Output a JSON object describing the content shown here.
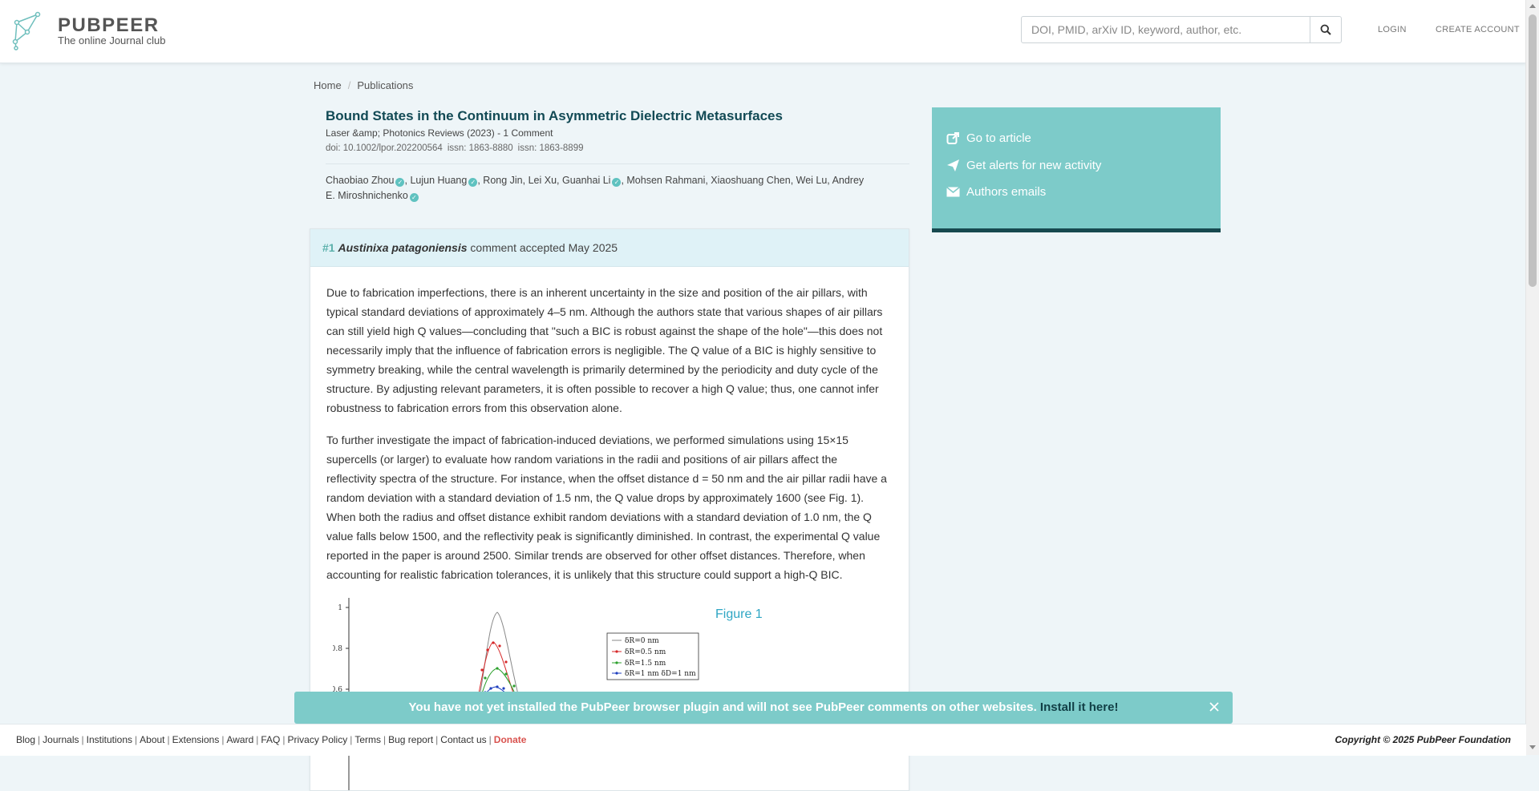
{
  "header": {
    "brand_name": "PUBPEER",
    "brand_tagline": "The online Journal club",
    "search_placeholder": "DOI, PMID, arXiv ID, keyword, author, etc.",
    "search_icon": "magnifier-icon",
    "login_label": "LOGIN",
    "create_account_label": "CREATE ACCOUNT"
  },
  "breadcrumb": {
    "home": "Home",
    "separator": "/",
    "current": "Publications"
  },
  "article": {
    "title": "Bound States in the Continuum in Asymmetric Dielectric Metasurfaces",
    "journal_line": "Laser &amp; Photonics Reviews (2023) - 1 Comment",
    "doi": "doi: 10.1002/lpor.202200564",
    "issn1": "issn: 1863-8880",
    "issn2": "issn: 1863-8899",
    "authors": [
      {
        "name": "Chaobiao Zhou",
        "verified": true,
        "sep": ", "
      },
      {
        "name": "Lujun Huang",
        "verified": true,
        "sep": ", "
      },
      {
        "name": "Rong Jin, Lei Xu, Guanhai Li",
        "verified": true,
        "sep": ", "
      },
      {
        "name": "Mohsen Rahmani, Xiaoshuang Chen, Wei Lu, Andrey E. Miroshnichenko",
        "verified": true,
        "sep": ""
      }
    ]
  },
  "comment": {
    "number": "#1",
    "author": "Austinixa patagoniensis",
    "status": "comment accepted May 2025",
    "paragraph1": "Due to fabrication imperfections, there is an inherent uncertainty in the size and position of the air pillars, with typical standard deviations of approximately 4–5 nm. Although the authors state that various shapes of air pillars can still yield high Q values—concluding that \"such a BIC is robust against the shape of the hole\"—this does not necessarily imply that the influence of fabrication errors is negligible. The Q value of a BIC is highly sensitive to symmetry breaking, while the central wavelength is primarily determined by the periodicity and duty cycle of the structure. By adjusting relevant parameters, it is often possible to recover a high Q value; thus, one cannot infer robustness to fabrication errors from this observation alone.",
    "paragraph2": "To further investigate the impact of fabrication-induced deviations, we performed simulations using 15×15 supercells (or larger) to evaluate how random variations in the radii and positions of air pillars affect the reflectivity spectra of the structure. For instance, when the offset distance d = 50 nm and the air pillar radii have a random deviation with a standard deviation of 1.5 nm, the Q value drops by approximately 1600 (see Fig. 1). When both the radius and offset distance exhibit random deviations with a standard deviation of 1.0 nm, the Q value falls below 1500, and the reflectivity peak is significantly diminished. In contrast, the experimental Q value reported in the paper is around 2500. Similar trends are observed for other offset distances. Therefore, when accounting for realistic fabrication tolerances, it is unlikely that this structure could support a high-Q BIC.",
    "figure_label": "Figure 1",
    "figure": {
      "y_ticks": [
        "1",
        "0.8",
        "0.6"
      ],
      "legend": [
        "δR=0 nm",
        "δR=0.5 nm",
        "δR=1.5 nm",
        "δR=1 nm  δD=1 nm"
      ],
      "series_colors": [
        "#888888",
        "#d62728",
        "#2ca02c",
        "#1f3fbf"
      ]
    }
  },
  "side_panel": {
    "go_to_article": "Go to article",
    "get_alerts": "Get alerts for new activity",
    "authors_emails": "Authors emails"
  },
  "banner": {
    "message": "You have not yet installed the PubPeer browser plugin and will not see PubPeer comments on other websites.",
    "link": "Install it here!"
  },
  "footer": {
    "links": [
      "Blog",
      "Journals",
      "Institutions",
      "About",
      "Extensions",
      "Award",
      "FAQ",
      "Privacy Policy",
      "Terms",
      "Bug report",
      "Contact us"
    ],
    "donate": "Donate",
    "copyright": "Copyright © 2025 PubPeer Foundation"
  },
  "colors": {
    "accent_teal": "#7dcbc9",
    "dark_teal": "#17494f",
    "title_color": "#124a55",
    "donate_red": "#d9534f"
  }
}
